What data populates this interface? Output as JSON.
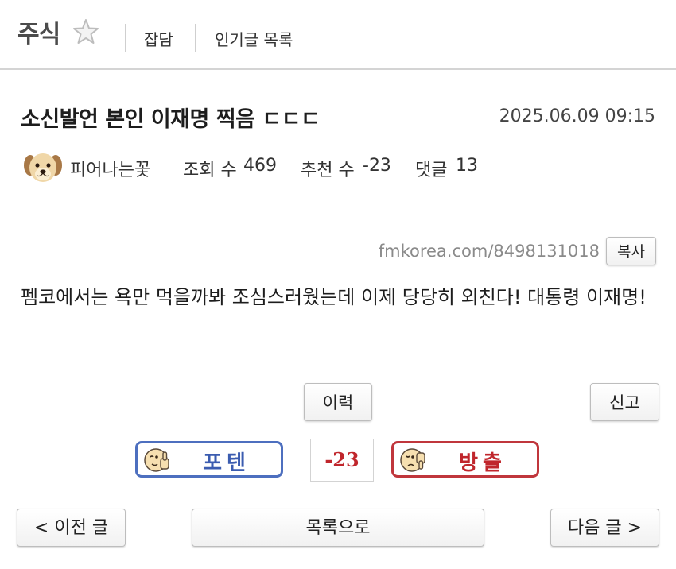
{
  "header": {
    "board_title": "주식",
    "nav": [
      "잡담",
      "인기글 목록"
    ]
  },
  "post": {
    "title": "소신발언 본인 이재명 찍음 ㄷㄷㄷ",
    "date": "2025.06.09 09:15",
    "author": "피어나는꽃",
    "views_label": "조회 수",
    "views": "469",
    "votes_label": "추천 수",
    "votes": "-23",
    "comments_label": "댓글",
    "comments": "13",
    "url": "fmkorea.com/8498131018",
    "copy_label": "복사",
    "body": "펨코에서는 욕만 먹을까봐 조심스러웠는데 이제 당당히 외친다! 대통령 이재명!"
  },
  "actions": {
    "history": "이력",
    "report": "신고",
    "upvote": "포텐",
    "downvote": "방출",
    "score": "-23"
  },
  "footer_nav": {
    "prev": "< 이전 글",
    "list": "목록으로",
    "next": "다음 글 >"
  },
  "colors": {
    "upvote_border": "#4d6fbf",
    "downvote_border": "#c0363c",
    "score_text": "#c0262c"
  }
}
